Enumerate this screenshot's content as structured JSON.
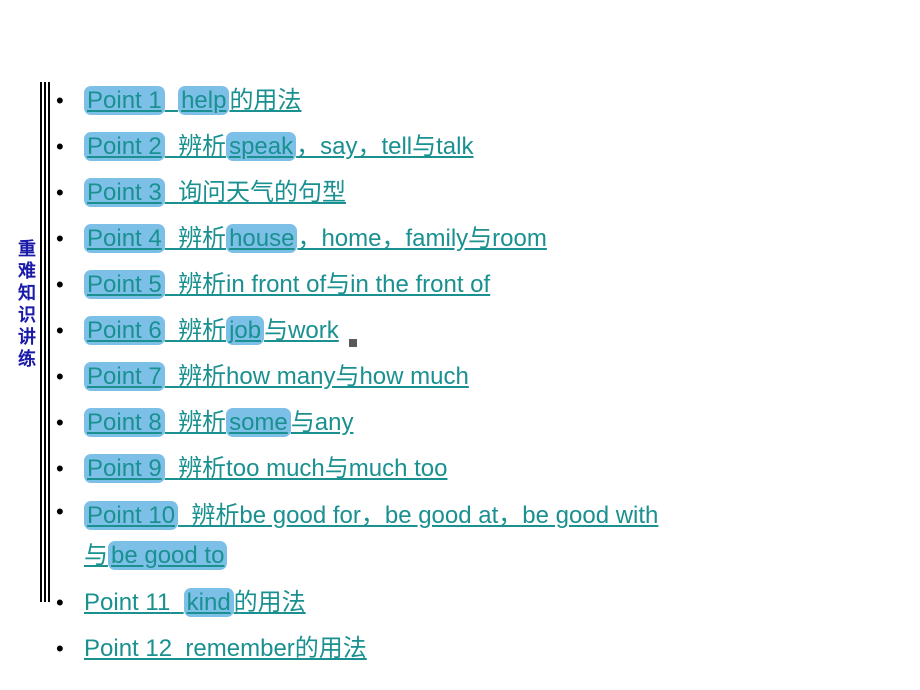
{
  "sidebar": {
    "chars": [
      "重",
      "难",
      "知",
      "识",
      "讲",
      "练"
    ]
  },
  "points": [
    {
      "num": "Point 1",
      "text": "help的用法",
      "highlight_word": "help"
    },
    {
      "num": "Point 2",
      "text": "辨析speak，say，tell与talk",
      "highlight_word": "speak"
    },
    {
      "num": "Point 3",
      "text": "询问天气的句型"
    },
    {
      "num": "Point 4",
      "text": "辨析house，home，family与room",
      "highlight_word": "house"
    },
    {
      "num": "Point 5",
      "text": "辨析in front of与in the front of"
    },
    {
      "num": "Point 6",
      "text": "辨析job与work",
      "highlight_word": "job"
    },
    {
      "num": "Point 7",
      "text": "辨析how many与how much"
    },
    {
      "num": "Point 8",
      "text": "辨析some与any",
      "highlight_word": "some"
    },
    {
      "num": "Point 9",
      "text": "辨析too much与much too"
    },
    {
      "num": "Point 10",
      "text": "辨析be good for，be good at，be good with",
      "line2_prefix": "与",
      "line2_hl": "be good to"
    },
    {
      "num": "Point 11",
      "text": "kind的用法",
      "highlight_word": "kind"
    },
    {
      "num": "Point 12",
      "text": "remember的用法"
    }
  ]
}
